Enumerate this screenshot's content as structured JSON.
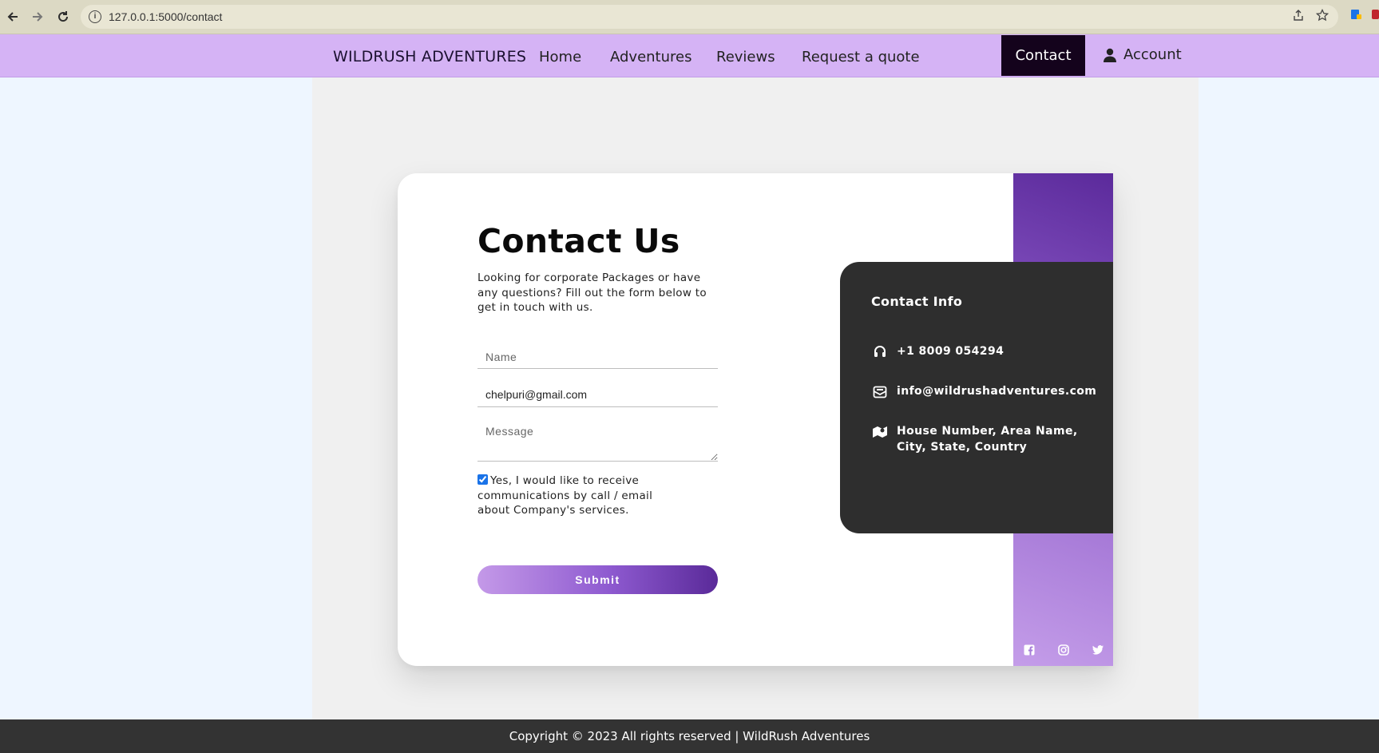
{
  "browser": {
    "url": "127.0.0.1:5000/contact",
    "back_icon": "arrow-left-icon",
    "forward_icon": "arrow-right-icon",
    "reload_icon": "reload-icon"
  },
  "nav": {
    "brand": "WILDRUSH ADVENTURES",
    "links": [
      {
        "label": "Home"
      },
      {
        "label": "Adventures"
      },
      {
        "label": "Reviews"
      },
      {
        "label": "Request a quote"
      }
    ],
    "active": "Contact",
    "account": "Account"
  },
  "form": {
    "title": "Contact Us",
    "subtitle": "Looking for corporate Packages or have any questions? Fill out the form below to get in touch with us.",
    "name_placeholder": "Name",
    "name_value": "",
    "email_value": "chelpuri@gmail.com",
    "message_placeholder": "Message",
    "consent_checked": true,
    "consent_label": "Yes, I would like to receive communications by call / email about Company's services.",
    "submit_label": "Submit"
  },
  "contact_info": {
    "title": "Contact Info",
    "phone": "+1 8009 054294",
    "email": "info@wildrushadventures.com",
    "address": "House Number, Area Name, City, State, Country"
  },
  "social_icons": [
    "facebook-icon",
    "instagram-icon",
    "twitter-icon"
  ],
  "colors": {
    "nav_bg": "#d5b3f5",
    "active_bg": "#14031c",
    "info_bg": "#2e2e2e",
    "footer_bg": "#333333",
    "accent_dark": "#5a2a99",
    "accent_light": "#c499e8"
  },
  "footer": {
    "text": "Copyright © 2023 All rights reserved | WildRush Adventures"
  }
}
